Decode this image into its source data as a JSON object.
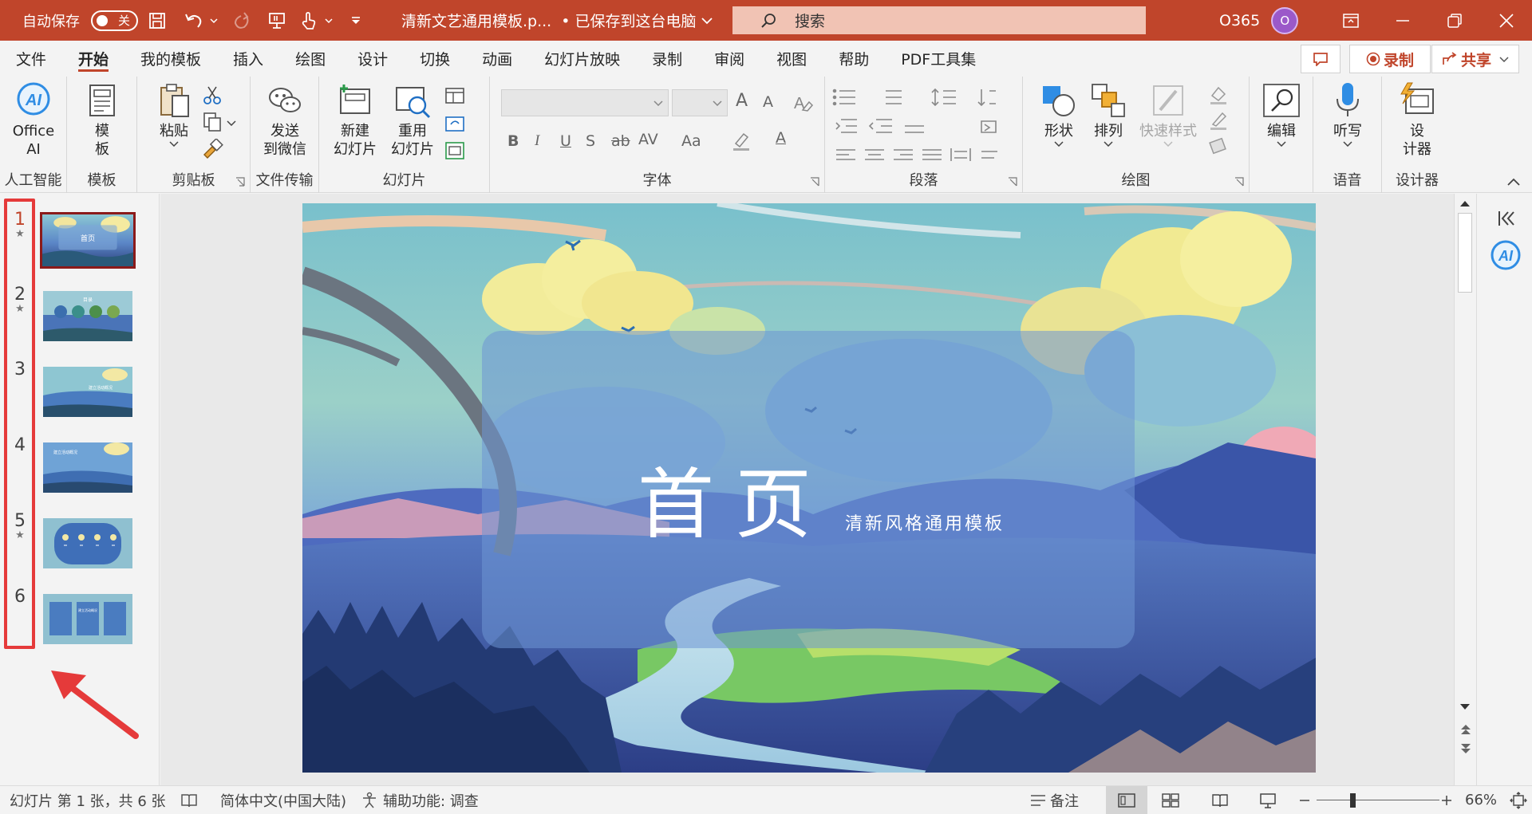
{
  "titlebar": {
    "autosave_label": "自动保存",
    "autosave_state": "关",
    "doc_title": "清新文艺通用模板.p...",
    "save_status": "• 已保存到这台电脑",
    "search_placeholder": "搜索",
    "account_label": "O365",
    "avatar_initial": "O",
    "bg_color": "#c0452b"
  },
  "menu": {
    "tabs": [
      "文件",
      "开始",
      "我的模板",
      "插入",
      "绘图",
      "设计",
      "切换",
      "动画",
      "幻灯片放映",
      "录制",
      "审阅",
      "视图",
      "帮助",
      "PDF工具集"
    ],
    "active_tab": "开始",
    "record_label": "录制",
    "share_label": "共享"
  },
  "ribbon": {
    "office_ai": {
      "line1": "Office",
      "line2": "AI",
      "group": "人工智能"
    },
    "template": {
      "line1": "模",
      "line2": "板",
      "group": "模板"
    },
    "clipboard": {
      "paste": "粘贴",
      "group": "剪贴板"
    },
    "file_transfer": {
      "line1": "发送",
      "line2": "到微信",
      "group": "文件传输"
    },
    "slides": {
      "new_line1": "新建",
      "new_line2": "幻灯片",
      "reuse_line1": "重用",
      "reuse_line2": "幻灯片",
      "group": "幻灯片"
    },
    "font": {
      "group": "字体",
      "b": "B",
      "i": "I",
      "u": "U",
      "s": "S",
      "abc": "ab",
      "av": "AV",
      "aa": "Aa",
      "a": "A",
      "grow": "A",
      "shrink": "A"
    },
    "paragraph": {
      "group": "段落"
    },
    "drawing": {
      "shape": "形状",
      "arrange": "排列",
      "quickstyle": "快速样式",
      "group": "绘图"
    },
    "editing": {
      "label": "编辑"
    },
    "voice": {
      "dictate": "听写",
      "group": "语音"
    },
    "designer": {
      "line1": "设",
      "line2": "计器",
      "group": "设计器"
    }
  },
  "slides_panel": {
    "numbers": [
      "1",
      "2",
      "3",
      "4",
      "5",
      "6"
    ],
    "star": "★",
    "selected": 1
  },
  "slide": {
    "title": "首页",
    "subtitle": "清新风格通用模板",
    "thumb1_text": "首页",
    "thumb2_text": "目录",
    "thumb3_text": "建立活动概况",
    "thumb4_text": "建立活动概况",
    "thumb6_text": "建立活动概况"
  },
  "status": {
    "slide_info": "幻灯片 第 1 张，共 6 张",
    "language": "简体中文(中国大陆)",
    "accessibility": "辅助功能: 调查",
    "notes": "备注",
    "zoom": "66%"
  },
  "colors": {
    "accent": "#c0452b",
    "annotation_red": "#e53a3a"
  }
}
